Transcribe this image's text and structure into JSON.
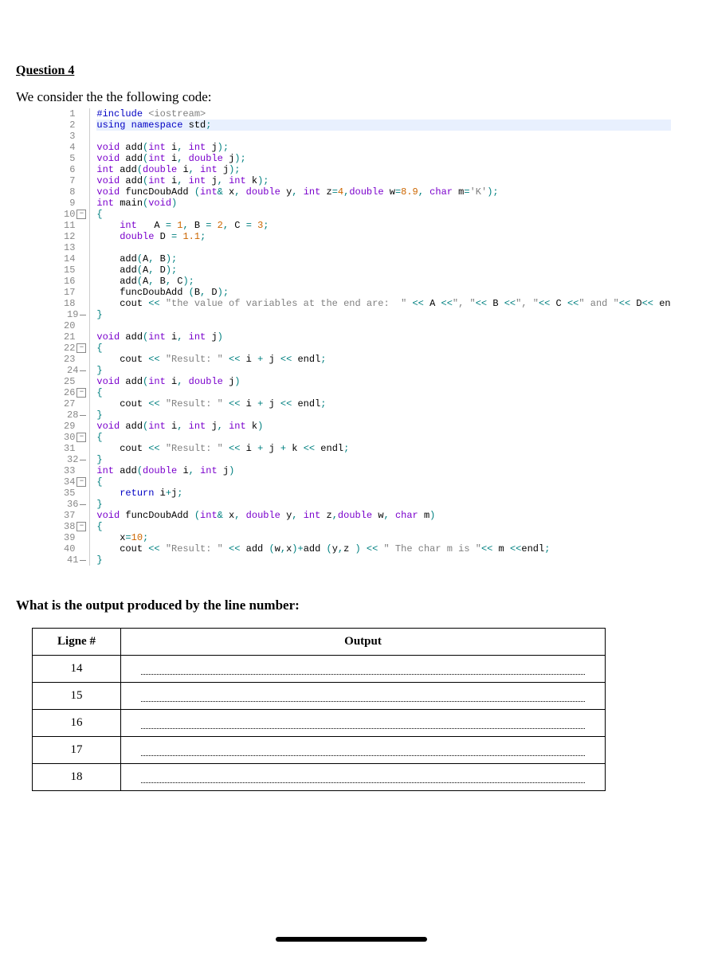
{
  "title": "Question 4",
  "intro": "We consider the the following code:",
  "question2": "What is the output produced by the line number:",
  "code_lines": [
    {
      "n": 1,
      "fold": "",
      "html": "<span class='kw'>#include</span> <span class='str'>&lt;iostream&gt;</span>"
    },
    {
      "n": 2,
      "fold": "",
      "html": "<span class='kw'>using namespace</span> std<span class='op'>;</span>",
      "cls": "hl-line"
    },
    {
      "n": 3,
      "fold": "",
      "html": ""
    },
    {
      "n": 4,
      "fold": "",
      "html": "<span class='ty'>void</span> add<span class='op'>(</span><span class='ty'>int</span> i<span class='op'>,</span> <span class='ty'>int</span> j<span class='op'>);</span>"
    },
    {
      "n": 5,
      "fold": "",
      "html": "<span class='ty'>void</span> add<span class='op'>(</span><span class='ty'>int</span> i<span class='op'>,</span> <span class='ty'>double</span> j<span class='op'>);</span>"
    },
    {
      "n": 6,
      "fold": "",
      "html": "<span class='ty'>int</span> add<span class='op'>(</span><span class='ty'>double</span> i<span class='op'>,</span> <span class='ty'>int</span> j<span class='op'>);</span>"
    },
    {
      "n": 7,
      "fold": "",
      "html": "<span class='ty'>void</span> add<span class='op'>(</span><span class='ty'>int</span> i<span class='op'>,</span> <span class='ty'>int</span> j<span class='op'>,</span> <span class='ty'>int</span> k<span class='op'>);</span>"
    },
    {
      "n": 8,
      "fold": "",
      "html": "<span class='ty'>void</span> funcDoubAdd <span class='op'>(</span><span class='ty'>int</span><span class='op'>&amp;</span> x<span class='op'>,</span> <span class='ty'>double</span> y<span class='op'>,</span> <span class='ty'>int</span> z<span class='op'>=</span><span class='num'>4</span><span class='op'>,</span><span class='ty'>double</span> w<span class='op'>=</span><span class='num'>8.9</span><span class='op'>,</span> <span class='ty'>char</span> m<span class='op'>=</span><span class='str'>'K'</span><span class='op'>);</span>"
    },
    {
      "n": 9,
      "fold": "",
      "html": "<span class='ty'>int</span> main<span class='op'>(</span><span class='ty'>void</span><span class='op'>)</span>"
    },
    {
      "n": 10,
      "fold": "box",
      "html": "<span class='op'>{</span>"
    },
    {
      "n": 11,
      "fold": "",
      "html": "    <span class='ty'>int</span>   A <span class='op'>=</span> <span class='num'>1</span><span class='op'>,</span> B <span class='op'>=</span> <span class='num'>2</span><span class='op'>,</span> C <span class='op'>=</span> <span class='num'>3</span><span class='op'>;</span>"
    },
    {
      "n": 12,
      "fold": "",
      "html": "    <span class='ty'>double</span> D <span class='op'>=</span> <span class='num'>1.1</span><span class='op'>;</span>"
    },
    {
      "n": 13,
      "fold": "",
      "html": ""
    },
    {
      "n": 14,
      "fold": "",
      "html": "    add<span class='op'>(</span>A<span class='op'>,</span> B<span class='op'>);</span>"
    },
    {
      "n": 15,
      "fold": "",
      "html": "    add<span class='op'>(</span>A<span class='op'>,</span> D<span class='op'>);</span>"
    },
    {
      "n": 16,
      "fold": "",
      "html": "    add<span class='op'>(</span>A<span class='op'>,</span> B<span class='op'>,</span> C<span class='op'>);</span>"
    },
    {
      "n": 17,
      "fold": "",
      "html": "    funcDoubAdd <span class='op'>(</span>B<span class='op'>,</span> D<span class='op'>);</span>"
    },
    {
      "n": 18,
      "fold": "",
      "html": "    cout <span class='op'>&lt;&lt;</span> <span class='str'>\"the value of variables at the end are:  \"</span> <span class='op'>&lt;&lt;</span> A <span class='op'>&lt;&lt;</span><span class='str'>\", \"</span><span class='op'>&lt;&lt;</span> B <span class='op'>&lt;&lt;</span><span class='str'>\", \"</span><span class='op'>&lt;&lt;</span> C <span class='op'>&lt;&lt;</span><span class='str'>\" and \"</span><span class='op'>&lt;&lt;</span> D<span class='op'>&lt;&lt;</span> en"
    },
    {
      "n": 19,
      "fold": "end",
      "html": "<span class='op'>}</span>"
    },
    {
      "n": 20,
      "fold": "",
      "html": ""
    },
    {
      "n": 21,
      "fold": "",
      "html": "<span class='ty'>void</span> add<span class='op'>(</span><span class='ty'>int</span> i<span class='op'>,</span> <span class='ty'>int</span> j<span class='op'>)</span>"
    },
    {
      "n": 22,
      "fold": "box",
      "html": "<span class='op'>{</span>"
    },
    {
      "n": 23,
      "fold": "",
      "html": "    cout <span class='op'>&lt;&lt;</span> <span class='str'>\"Result: \"</span> <span class='op'>&lt;&lt;</span> i <span class='op'>+</span> j <span class='op'>&lt;&lt;</span> endl<span class='op'>;</span>"
    },
    {
      "n": 24,
      "fold": "end",
      "html": "<span class='op'>}</span>"
    },
    {
      "n": 25,
      "fold": "",
      "html": "<span class='ty'>void</span> add<span class='op'>(</span><span class='ty'>int</span> i<span class='op'>,</span> <span class='ty'>double</span> j<span class='op'>)</span>"
    },
    {
      "n": 26,
      "fold": "box",
      "html": "<span class='op'>{</span>"
    },
    {
      "n": 27,
      "fold": "",
      "html": "    cout <span class='op'>&lt;&lt;</span> <span class='str'>\"Result: \"</span> <span class='op'>&lt;&lt;</span> i <span class='op'>+</span> j <span class='op'>&lt;&lt;</span> endl<span class='op'>;</span>"
    },
    {
      "n": 28,
      "fold": "end",
      "html": "<span class='op'>}</span>"
    },
    {
      "n": 29,
      "fold": "",
      "html": "<span class='ty'>void</span> add<span class='op'>(</span><span class='ty'>int</span> i<span class='op'>,</span> <span class='ty'>int</span> j<span class='op'>,</span> <span class='ty'>int</span> k<span class='op'>)</span>"
    },
    {
      "n": 30,
      "fold": "box",
      "html": "<span class='op'>{</span>"
    },
    {
      "n": 31,
      "fold": "",
      "html": "    cout <span class='op'>&lt;&lt;</span> <span class='str'>\"Result: \"</span> <span class='op'>&lt;&lt;</span> i <span class='op'>+</span> j <span class='op'>+</span> k <span class='op'>&lt;&lt;</span> endl<span class='op'>;</span>"
    },
    {
      "n": 32,
      "fold": "end",
      "html": "<span class='op'>}</span>"
    },
    {
      "n": 33,
      "fold": "",
      "html": "<span class='ty'>int</span> add<span class='op'>(</span><span class='ty'>double</span> i<span class='op'>,</span> <span class='ty'>int</span> j<span class='op'>)</span>"
    },
    {
      "n": 34,
      "fold": "box",
      "html": "<span class='op'>{</span>"
    },
    {
      "n": 35,
      "fold": "",
      "html": "    <span class='kw'>return</span> i<span class='op'>+</span>j<span class='op'>;</span>"
    },
    {
      "n": 36,
      "fold": "end",
      "html": "<span class='op'>}</span>"
    },
    {
      "n": 37,
      "fold": "",
      "html": "<span class='ty'>void</span> funcDoubAdd <span class='op'>(</span><span class='ty'>int</span><span class='op'>&amp;</span> x<span class='op'>,</span> <span class='ty'>double</span> y<span class='op'>,</span> <span class='ty'>int</span> z<span class='op'>,</span><span class='ty'>double</span> w<span class='op'>,</span> <span class='ty'>char</span> m<span class='op'>)</span>"
    },
    {
      "n": 38,
      "fold": "box",
      "html": "<span class='op'>{</span>"
    },
    {
      "n": 39,
      "fold": "",
      "html": "    x<span class='op'>=</span><span class='num'>10</span><span class='op'>;</span>"
    },
    {
      "n": 40,
      "fold": "",
      "html": "    cout <span class='op'>&lt;&lt;</span> <span class='str'>\"Result: \"</span> <span class='op'>&lt;&lt;</span> add <span class='op'>(</span>w<span class='op'>,</span>x<span class='op'>)+</span>add <span class='op'>(</span>y<span class='op'>,</span>z <span class='op'>)</span> <span class='op'>&lt;&lt;</span> <span class='str'>\" The char m is \"</span><span class='op'>&lt;&lt;</span> m <span class='op'>&lt;&lt;</span>endl<span class='op'>;</span>"
    },
    {
      "n": 41,
      "fold": "end",
      "html": "<span class='op'>}</span>"
    }
  ],
  "table": {
    "headers": [
      "Ligne #",
      "Output"
    ],
    "rows": [
      "14",
      "15",
      "16",
      "17",
      "18"
    ]
  }
}
